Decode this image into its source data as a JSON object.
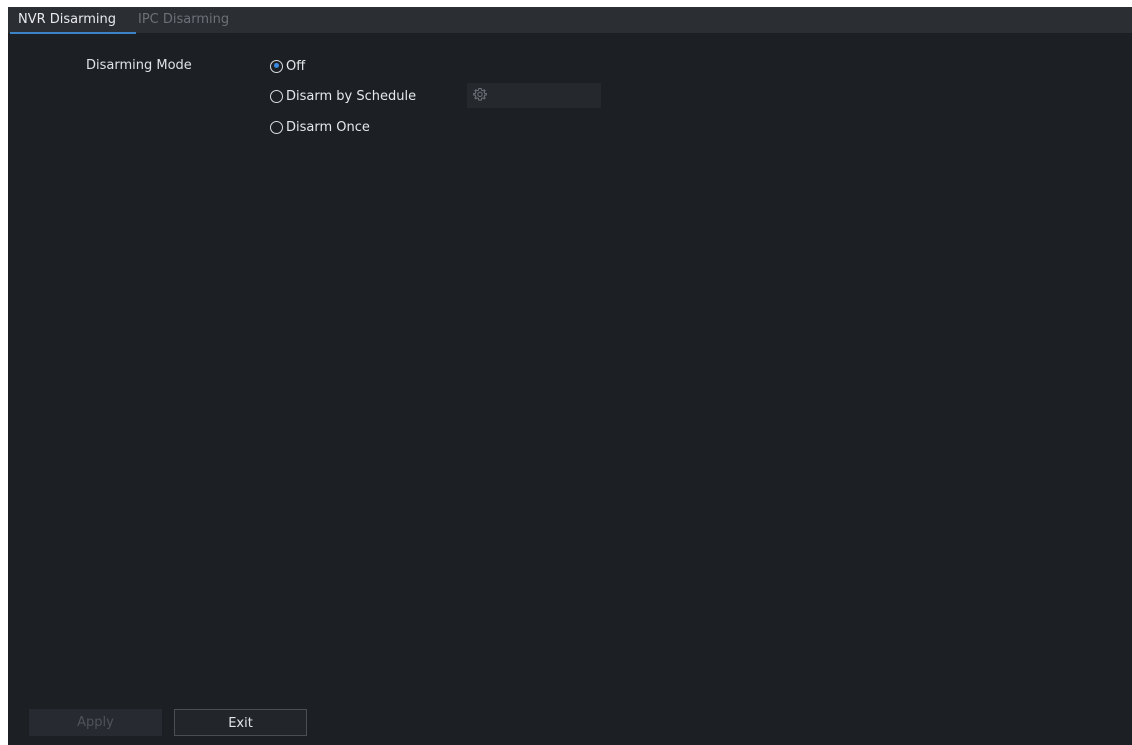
{
  "tabs": [
    {
      "label": "NVR Disarming",
      "active": true
    },
    {
      "label": "IPC Disarming",
      "active": false
    }
  ],
  "form": {
    "disarming_mode_label": "Disarming Mode",
    "options": [
      {
        "label": "Off",
        "selected": true
      },
      {
        "label": "Disarm by Schedule",
        "selected": false
      },
      {
        "label": "Disarm Once",
        "selected": false
      }
    ],
    "schedule_settings_icon": "gear-icon"
  },
  "buttons": {
    "apply": {
      "label": "Apply",
      "enabled": false
    },
    "exit": {
      "label": "Exit",
      "enabled": true
    }
  },
  "colors": {
    "background": "#1c1f23",
    "tab_bar": "#2b2e33",
    "accent": "#3a8be0"
  }
}
